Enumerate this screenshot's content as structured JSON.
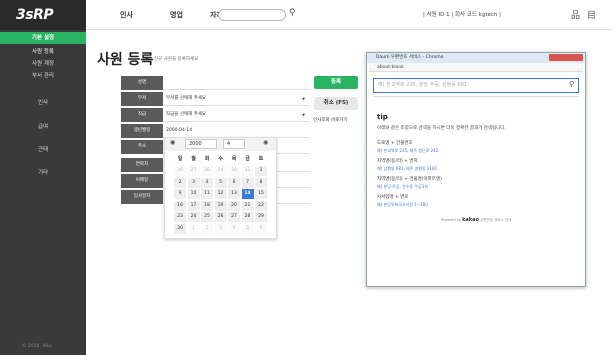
{
  "brand": {
    "logo": "3sRP",
    "copyright": "© 2020. 4lku"
  },
  "sidebar": {
    "items": [
      {
        "label": "기본 설정"
      },
      {
        "label": "사원 등록"
      },
      {
        "label": "사원 계정"
      },
      {
        "label": "부서 관리"
      },
      {
        "label": "인사"
      },
      {
        "label": "급여"
      },
      {
        "label": "근태"
      },
      {
        "label": "기타"
      }
    ]
  },
  "topbar": {
    "nav": [
      "인사",
      "영업",
      "자재"
    ],
    "search_placeholder": "",
    "userinfo": "| 사원 ID 1 | 회사 코드 kgtech |"
  },
  "page": {
    "title": "사원 등록",
    "subtitle": "신규 사원을 등록하세요"
  },
  "form": {
    "rows": [
      {
        "label": "성명",
        "value": ""
      },
      {
        "label": "부서",
        "value": "부서를 선택해 주세요",
        "arrow": "▼"
      },
      {
        "label": "직급",
        "value": "직급을 선택해 주세요",
        "arrow": "▼"
      },
      {
        "label": "생년월일",
        "value": "2000-04-14"
      },
      {
        "label": "주소",
        "value": ""
      },
      {
        "label": "연락처",
        "value": ""
      },
      {
        "label": "이메일",
        "value": ""
      },
      {
        "label": "입사일자",
        "value": ""
      }
    ],
    "register_button": "등록",
    "cancel_button": "취소 (F5)",
    "lookup_link": "인사조회 바로가기"
  },
  "calendar": {
    "year": "2000",
    "month": "4",
    "weekdays": [
      "일",
      "월",
      "화",
      "수",
      "목",
      "금",
      "토"
    ],
    "selected_day": 14,
    "weeks": [
      [
        {
          "d": "26",
          "o": 1
        },
        {
          "d": "27",
          "o": 1
        },
        {
          "d": "28",
          "o": 1
        },
        {
          "d": "29",
          "o": 1
        },
        {
          "d": "30",
          "o": 1
        },
        {
          "d": "31",
          "o": 1
        },
        {
          "d": "1",
          "o": 0
        }
      ],
      [
        {
          "d": "2",
          "o": 0
        },
        {
          "d": "3",
          "o": 0
        },
        {
          "d": "4",
          "o": 0
        },
        {
          "d": "5",
          "o": 0
        },
        {
          "d": "6",
          "o": 0
        },
        {
          "d": "7",
          "o": 0
        },
        {
          "d": "8",
          "o": 0
        }
      ],
      [
        {
          "d": "9",
          "o": 0
        },
        {
          "d": "10",
          "o": 0
        },
        {
          "d": "11",
          "o": 0
        },
        {
          "d": "12",
          "o": 0
        },
        {
          "d": "13",
          "o": 0
        },
        {
          "d": "14",
          "o": 0
        },
        {
          "d": "15",
          "o": 0
        }
      ],
      [
        {
          "d": "16",
          "o": 0
        },
        {
          "d": "17",
          "o": 0
        },
        {
          "d": "18",
          "o": 0
        },
        {
          "d": "19",
          "o": 0
        },
        {
          "d": "20",
          "o": 0
        },
        {
          "d": "21",
          "o": 0
        },
        {
          "d": "22",
          "o": 0
        }
      ],
      [
        {
          "d": "23",
          "o": 0
        },
        {
          "d": "24",
          "o": 0
        },
        {
          "d": "25",
          "o": 0
        },
        {
          "d": "26",
          "o": 0
        },
        {
          "d": "27",
          "o": 0
        },
        {
          "d": "28",
          "o": 0
        },
        {
          "d": "29",
          "o": 0
        }
      ],
      [
        {
          "d": "30",
          "o": 0
        },
        {
          "d": "1",
          "o": 1
        },
        {
          "d": "2",
          "o": 1
        },
        {
          "d": "3",
          "o": 1
        },
        {
          "d": "4",
          "o": 1
        },
        {
          "d": "5",
          "o": 1
        },
        {
          "d": "6",
          "o": 1
        }
      ]
    ]
  },
  "popup": {
    "title": "Daum 우편번호 서비스 - Chrome",
    "address": "about:blank",
    "search_placeholder": "예) 판교역로 235, 분당 주공, 삼평동 681",
    "tip_title": "tip",
    "tip_desc": "아래와 같은 조합으로 검색을 하시면 더욱 정확한 결과가 검색됩니다.",
    "examples": [
      {
        "title": "도로명 + 건물번호",
        "ex": "예) 판교역로 235, 제주 첨단로 242"
      },
      {
        "title": "지역명(동/리) + 번지",
        "ex": "예) 삼평동 681, 제주 영평동 2181"
      },
      {
        "title": "지역명(동/리) + 건물명(아파트명)",
        "ex": "예) 분당 주공, 연수동 주공3차"
      },
      {
        "title": "사서함명 + 번호",
        "ex": "예) 분당우체국사서함 1~100"
      }
    ],
    "footer_brand": "kakao",
    "footer_text": "Powered by",
    "footer_suffix": "우편번호 서비스 안내"
  }
}
